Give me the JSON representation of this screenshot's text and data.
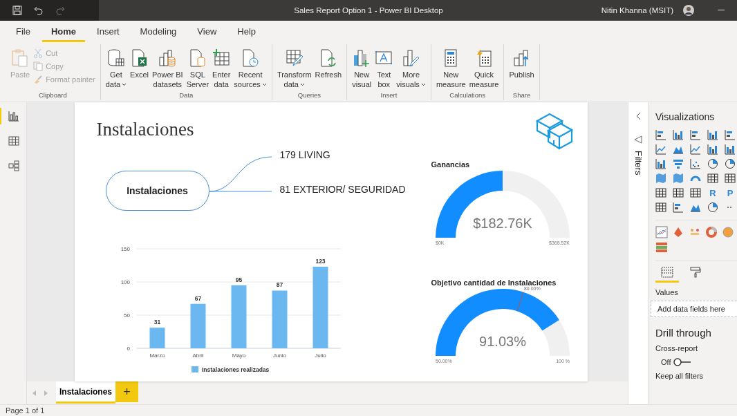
{
  "window": {
    "title": "Sales Report Option 1 - Power BI Desktop",
    "user": "Nitin Khanna (MSIT)"
  },
  "menu_tabs": [
    {
      "label": "File",
      "selected": false
    },
    {
      "label": "Home",
      "selected": true
    },
    {
      "label": "Insert",
      "selected": false
    },
    {
      "label": "Modeling",
      "selected": false
    },
    {
      "label": "View",
      "selected": false
    },
    {
      "label": "Help",
      "selected": false
    }
  ],
  "ribbon_groups": [
    {
      "label": "Clipboard",
      "buttons": [
        {
          "kind": "large",
          "lines": [
            "Paste"
          ],
          "dropdown": false,
          "disabled": true
        },
        {
          "kind": "small",
          "lines": [
            "Cut"
          ],
          "disabled": true
        },
        {
          "kind": "small",
          "lines": [
            "Copy"
          ],
          "disabled": true
        },
        {
          "kind": "small",
          "lines": [
            "Format painter"
          ],
          "disabled": true
        }
      ]
    },
    {
      "label": "Data",
      "buttons": [
        {
          "kind": "large",
          "lines": [
            "Get",
            "data"
          ],
          "dropdown": true,
          "disabled": false
        },
        {
          "kind": "large",
          "lines": [
            "Excel"
          ],
          "dropdown": false,
          "disabled": false
        },
        {
          "kind": "large",
          "lines": [
            "Power BI",
            "datasets"
          ],
          "dropdown": false,
          "disabled": false
        },
        {
          "kind": "large",
          "lines": [
            "SQL",
            "Server"
          ],
          "dropdown": false,
          "disabled": false
        },
        {
          "kind": "large",
          "lines": [
            "Enter",
            "data"
          ],
          "dropdown": false,
          "disabled": false
        },
        {
          "kind": "large",
          "lines": [
            "Recent",
            "sources"
          ],
          "dropdown": true,
          "disabled": false
        }
      ]
    },
    {
      "label": "Queries",
      "buttons": [
        {
          "kind": "large",
          "lines": [
            "Transform",
            "data"
          ],
          "dropdown": true,
          "disabled": false
        },
        {
          "kind": "large",
          "lines": [
            "Refresh"
          ],
          "dropdown": false,
          "disabled": false
        }
      ]
    },
    {
      "label": "Insert",
      "buttons": [
        {
          "kind": "large",
          "lines": [
            "New",
            "visual"
          ],
          "dropdown": false,
          "disabled": false
        },
        {
          "kind": "large",
          "lines": [
            "Text",
            "box"
          ],
          "dropdown": false,
          "disabled": false
        },
        {
          "kind": "large",
          "lines": [
            "More",
            "visuals"
          ],
          "dropdown": true,
          "disabled": false
        }
      ]
    },
    {
      "label": "Calculations",
      "buttons": [
        {
          "kind": "large",
          "lines": [
            "New",
            "measure"
          ],
          "dropdown": false,
          "disabled": false
        },
        {
          "kind": "large",
          "lines": [
            "Quick",
            "measure"
          ],
          "dropdown": false,
          "disabled": false
        }
      ]
    },
    {
      "label": "Share",
      "buttons": [
        {
          "kind": "large",
          "lines": [
            "Publish"
          ],
          "dropdown": false,
          "disabled": false
        }
      ]
    }
  ],
  "nav_rail": [
    {
      "selected": true
    },
    {
      "selected": false
    },
    {
      "selected": false
    }
  ],
  "report": {
    "title": "Instalaciones",
    "mind_map": {
      "root": "Instalaciones",
      "branches": [
        "179 LIVING",
        "81 EXTERIOR/ SEGURIDAD"
      ]
    },
    "bar_chart": {
      "chart_data": {
        "type": "bar",
        "categories": [
          "Marzo",
          "Abril",
          "Mayo",
          "Junio",
          "Julio"
        ],
        "series": [
          {
            "name": "Instalaciones realizadas",
            "color": "#6bb7f0",
            "values": [
              31,
              67,
              95,
              87,
              123
            ]
          }
        ],
        "ylim": [
          0,
          150
        ],
        "yticks": [
          0,
          50,
          100,
          150
        ],
        "data_labels": true
      }
    },
    "gauges": [
      {
        "title": "Ganancias",
        "value": "$182.76K",
        "min": "$0K",
        "max": "$365.52K"
      },
      {
        "title": "Objetivo cantidad de Instalaciones",
        "value": "91.03%",
        "min": "50.00%",
        "max": "100 %",
        "target": "80.00%"
      }
    ]
  },
  "page_tabs": [
    {
      "label": "Instalaciones",
      "selected": true
    }
  ],
  "add_page": "+",
  "status_bar": "Page 1 of 1",
  "filters_pane": {
    "label": "Filters"
  },
  "visualizations": {
    "title": "Visualizations",
    "script_visuals": [
      "R",
      "P"
    ],
    "well_tabs": [
      {
        "selected": true
      },
      {
        "selected": false
      }
    ],
    "values_label": "Values",
    "drop_hint": "Add data fields here",
    "drill_through": {
      "title": "Drill through",
      "cross_report": {
        "label": "Cross-report",
        "state": "Off",
        "on": false
      },
      "keep_all_filters": {
        "label": "Keep all filters"
      }
    }
  }
}
